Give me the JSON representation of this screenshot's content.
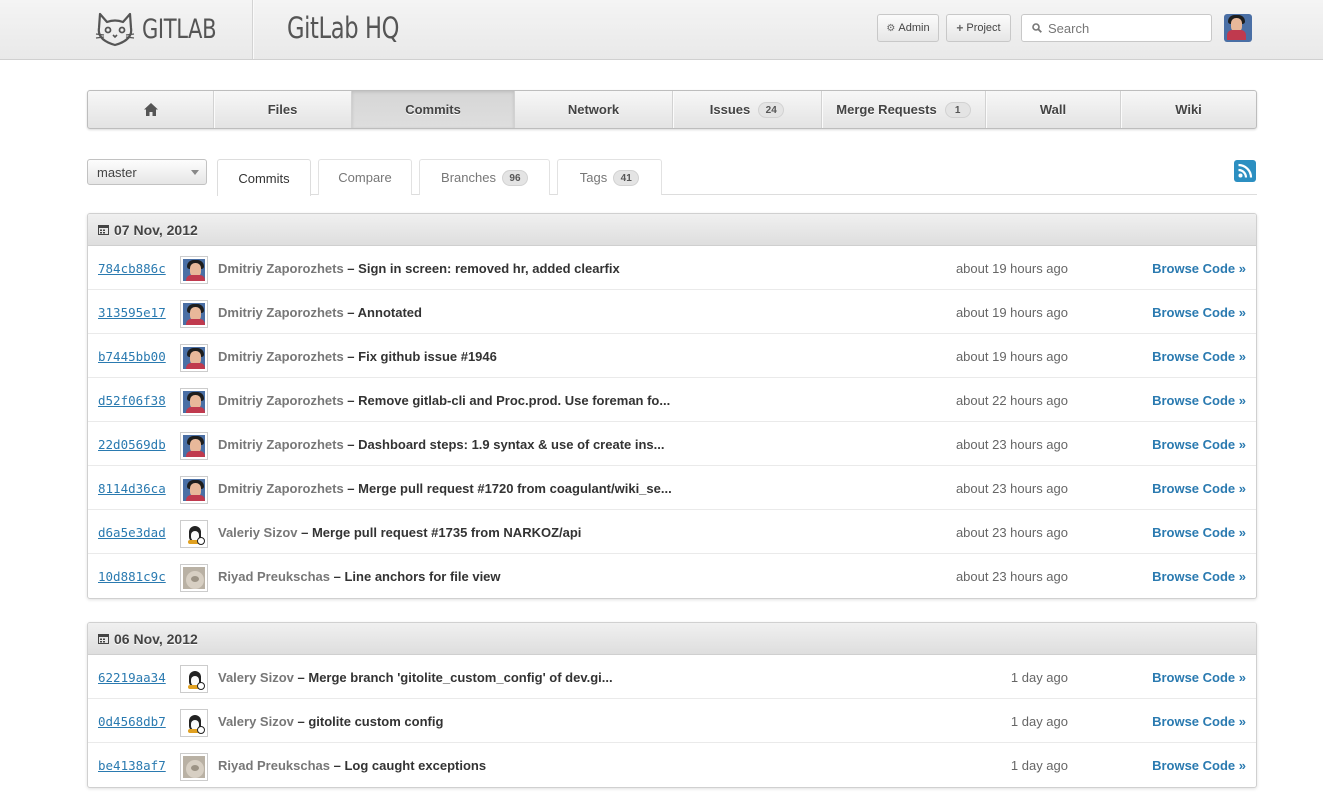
{
  "header": {
    "logo_text": "GITLAB",
    "project_title": "GitLab HQ",
    "admin_label": "Admin",
    "project_label": "Project",
    "search_placeholder": "Search"
  },
  "nav": {
    "items": [
      {
        "label": "",
        "icon": "home-icon"
      },
      {
        "label": "Files"
      },
      {
        "label": "Commits",
        "active": true
      },
      {
        "label": "Network"
      },
      {
        "label": "Issues",
        "count": "24"
      },
      {
        "label": "Merge Requests",
        "count": "1"
      },
      {
        "label": "Wall"
      },
      {
        "label": "Wiki"
      }
    ]
  },
  "subnav": {
    "branch": "master",
    "tabs": [
      {
        "label": "Commits",
        "active": true
      },
      {
        "label": "Compare"
      },
      {
        "label": "Branches",
        "count": "96"
      },
      {
        "label": "Tags",
        "count": "41"
      }
    ]
  },
  "groups": [
    {
      "date": "07 Nov, 2012",
      "commits": [
        {
          "sha": "784cb886c",
          "author": "Dmitriy Zaporozhets",
          "message": "Sign in screen: removed hr, added clearfix",
          "time": "about 19 hours ago",
          "avatar": "person"
        },
        {
          "sha": "313595e17",
          "author": "Dmitriy Zaporozhets",
          "message": "Annotated",
          "time": "about 19 hours ago",
          "avatar": "person"
        },
        {
          "sha": "b7445bb00",
          "author": "Dmitriy Zaporozhets",
          "message": "Fix github issue #1946",
          "time": "about 19 hours ago",
          "avatar": "person"
        },
        {
          "sha": "d52f06f38",
          "author": "Dmitriy Zaporozhets",
          "message": "Remove gitlab-cli and Proc.prod. Use foreman fo...",
          "time": "about 22 hours ago",
          "avatar": "person"
        },
        {
          "sha": "22d0569db",
          "author": "Dmitriy Zaporozhets",
          "message": "Dashboard steps: 1.9 syntax & use of create ins...",
          "time": "about 23 hours ago",
          "avatar": "person"
        },
        {
          "sha": "8114d36ca",
          "author": "Dmitriy Zaporozhets",
          "message": "Merge pull request #1720 from coagulant/wiki_se...",
          "time": "about 23 hours ago",
          "avatar": "person"
        },
        {
          "sha": "d6a5e3dad",
          "author": "Valeriy Sizov",
          "message": "Merge pull request #1735 from NARKOZ/api",
          "time": "about 23 hours ago",
          "avatar": "linux"
        },
        {
          "sha": "10d881c9c",
          "author": "Riyad Preukschas",
          "message": "Line anchors for file view",
          "time": "about 23 hours ago",
          "avatar": "cat"
        }
      ]
    },
    {
      "date": "06 Nov, 2012",
      "commits": [
        {
          "sha": "62219aa34",
          "author": "Valery Sizov",
          "message": "Merge branch 'gitolite_custom_config' of dev.gi...",
          "time": "1 day ago",
          "avatar": "linux"
        },
        {
          "sha": "0d4568db7",
          "author": "Valery Sizov",
          "message": "gitolite custom config",
          "time": "1 day ago",
          "avatar": "linux"
        },
        {
          "sha": "be4138af7",
          "author": "Riyad Preukschas",
          "message": "Log caught exceptions",
          "time": "1 day ago",
          "avatar": "cat"
        }
      ]
    }
  ],
  "labels": {
    "separator": " – ",
    "browse_code": "Browse Code »"
  },
  "colors": {
    "link": "#2a7ab0",
    "rss": "#2c8fc1"
  }
}
